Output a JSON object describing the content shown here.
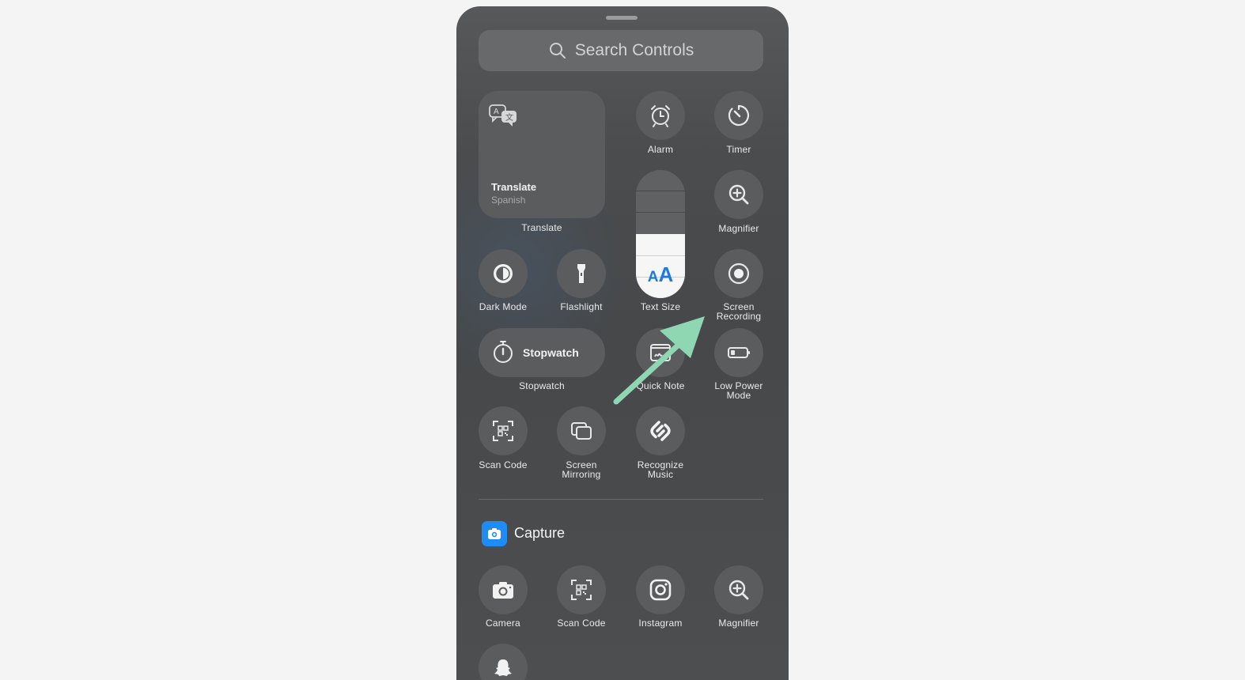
{
  "search": {
    "placeholder": "Search Controls",
    "icon": "search-icon"
  },
  "translate_tile": {
    "title": "Translate",
    "subtitle": "Spanish",
    "label": "Translate",
    "icon": "translate-icon"
  },
  "controls": {
    "alarm": "Alarm",
    "timer": "Timer",
    "magnifier": "Magnifier",
    "dark_mode": "Dark Mode",
    "flashlight": "Flashlight",
    "text_size": "Text Size",
    "screen_recording_1": "Screen",
    "screen_recording_2": "Recording",
    "stopwatch_tile": "Stopwatch",
    "stopwatch": "Stopwatch",
    "quick_note": "Quick Note",
    "low_power_1": "Low Power",
    "low_power_2": "Mode",
    "scan_code": "Scan Code",
    "screen_mirroring_1": "Screen",
    "screen_mirroring_2": "Mirroring",
    "recognize_music_1": "Recognize",
    "recognize_music_2": "Music"
  },
  "text_size_glyphs": {
    "small": "A",
    "big": "A"
  },
  "capture_section": {
    "title": "Capture",
    "items": [
      {
        "label": "Camera",
        "icon": "camera-icon"
      },
      {
        "label": "Scan Code",
        "icon": "qr-scan-icon"
      },
      {
        "label": "Instagram",
        "icon": "instagram-icon"
      },
      {
        "label": "Magnifier",
        "icon": "magnifier-icon"
      }
    ]
  },
  "colors": {
    "panel": "#4a4c4e",
    "control_bg": "#5a5c5e",
    "accent_blue": "#1e8cf5",
    "annotation_arrow": "#8fd6b2"
  }
}
